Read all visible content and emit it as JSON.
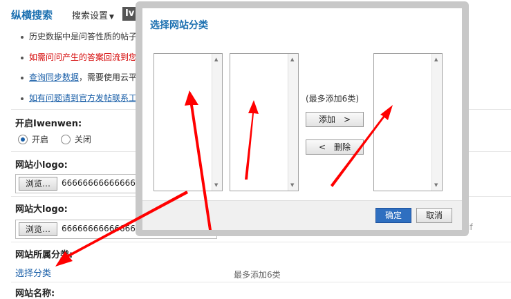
{
  "header": {
    "brand": "纵横搜索",
    "settings_label": "搜索设置",
    "settings_caret": "▼",
    "tab_tag": "Iv"
  },
  "bullets": [
    {
      "text": "历史数据中是问答性质的帖子"
    },
    {
      "text": "如需问问产生的答案回流到您"
    },
    {
      "link": "查询同步数据",
      "text": "，需要使用云平"
    },
    {
      "link": "如有问题请到官方发帖联系工"
    }
  ],
  "sections": {
    "open_label": "开启Iwenwen:",
    "radio_on": "开启",
    "radio_off": "关闭",
    "small_logo_label": "网站小logo:",
    "big_logo_label": "网站大logo:",
    "browse_label": "浏览…",
    "small_logo_value": "66666666666666",
    "big_logo_value": "66666666666666",
    "gif_hint": "if",
    "category_label": "网站所属分类:",
    "select_category_link": "选择分类",
    "max_note": "最多添加6类",
    "site_name_label": "网站名称:"
  },
  "dialog": {
    "title": "选择网站分类",
    "max_add": "(最多添加6类)",
    "add_button": "添加　>",
    "remove_button": "<　删除",
    "ok_button": "确定",
    "cancel_button": "取消"
  },
  "colors": {
    "accent_blue": "#1a6fb0",
    "annotation_red": "#ff0000",
    "ok_button": "#2f6fc0"
  }
}
